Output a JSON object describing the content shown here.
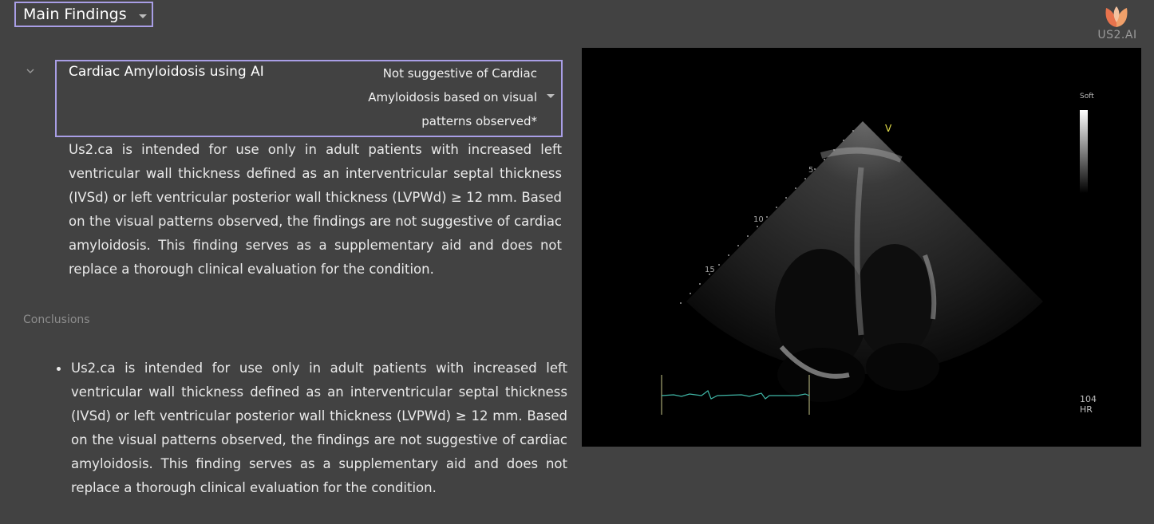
{
  "header": {
    "section_select": "Main Findings",
    "logo_text": "US2.AI"
  },
  "finding": {
    "label": "Cardiac Amyloidosis using AI",
    "value": "Not suggestive of Cardiac Amyloidosis based on visual patterns observed*",
    "description": "Us2.ca is intended for use only in adult patients with increased left ventricular wall thickness defined as an interventricular septal thickness (IVSd) or left ventricular posterior wall thickness (LVPWd) ≥ 12 mm. Based on the visual patterns observed, the findings are not suggestive of cardiac amyloidosis. This finding serves as a supplementary aid and does not replace a thorough clinical evaluation for the condition."
  },
  "conclusions": {
    "label": "Conclusions",
    "items": [
      "Us2.ca is intended for use only in adult patients with increased left ventricular wall thickness defined as an interventricular septal thickness (IVSd) or left ventricular posterior wall thickness (LVPWd) ≥ 12 mm. Based on the visual patterns observed, the findings are not suggestive of cardiac amyloidosis. This finding serves as a supplementary aid and does not replace a thorough clinical evaluation for the condition."
    ]
  },
  "echo_image": {
    "scale_label": "Soft",
    "depth_marks": [
      "5",
      "10",
      "15"
    ],
    "orientation_marker": "V",
    "hr_value": "104",
    "hr_unit": "HR"
  },
  "colors": {
    "background": "#424242",
    "accent_border": "#a99ee6",
    "ecg_trace": "#3fb6a6",
    "orientation_marker": "#e5e04a"
  }
}
